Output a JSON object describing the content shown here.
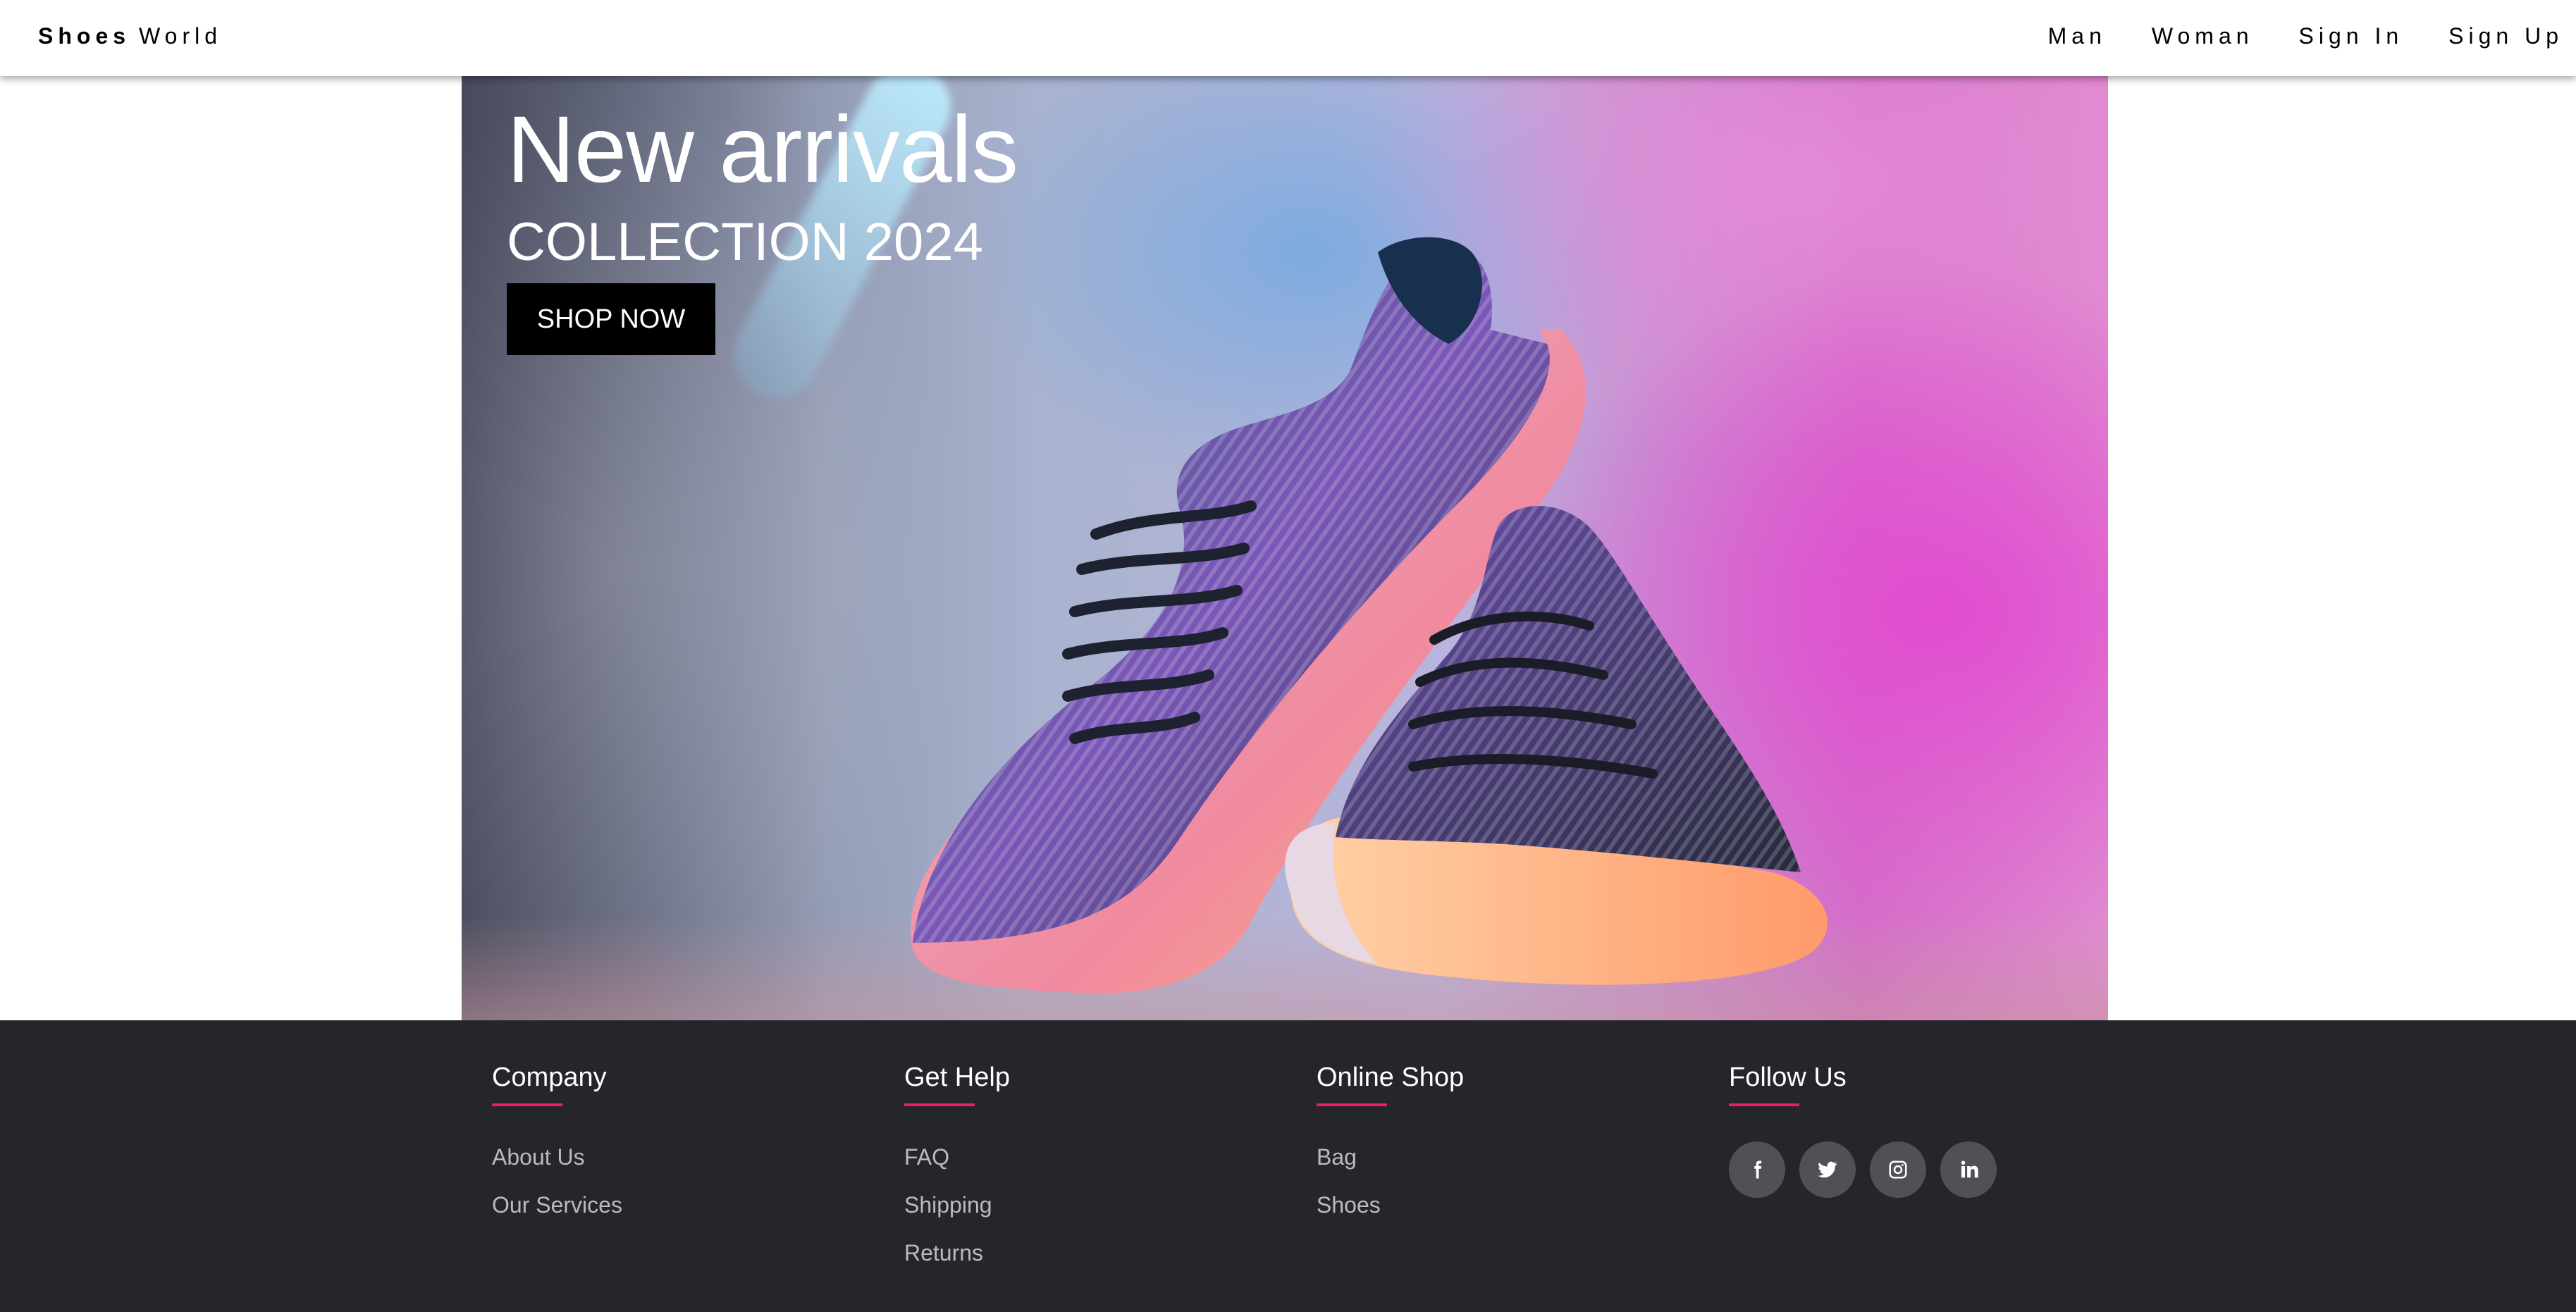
{
  "navbar": {
    "brand_bold": "Shoes",
    "brand_rest": "World",
    "links": [
      "Man",
      "Woman",
      "Sign In",
      "Sign Up"
    ]
  },
  "hero": {
    "title": "New arrivals",
    "subtitle": "COLLECTION 2024",
    "cta": "SHOP NOW"
  },
  "footer": {
    "columns": [
      {
        "heading": "Company",
        "links": [
          "About Us",
          "Our Services"
        ]
      },
      {
        "heading": "Get Help",
        "links": [
          "FAQ",
          "Shipping",
          "Returns"
        ]
      },
      {
        "heading": "Online Shop",
        "links": [
          "Bag",
          "Shoes"
        ]
      },
      {
        "heading": "Follow Us",
        "social": [
          "facebook-icon",
          "twitter-icon",
          "instagram-icon",
          "linkedin-icon"
        ]
      }
    ]
  },
  "colors": {
    "footer_bg": "#24262b",
    "accent_underline": "#e91e63",
    "button_bg": "#000000"
  }
}
